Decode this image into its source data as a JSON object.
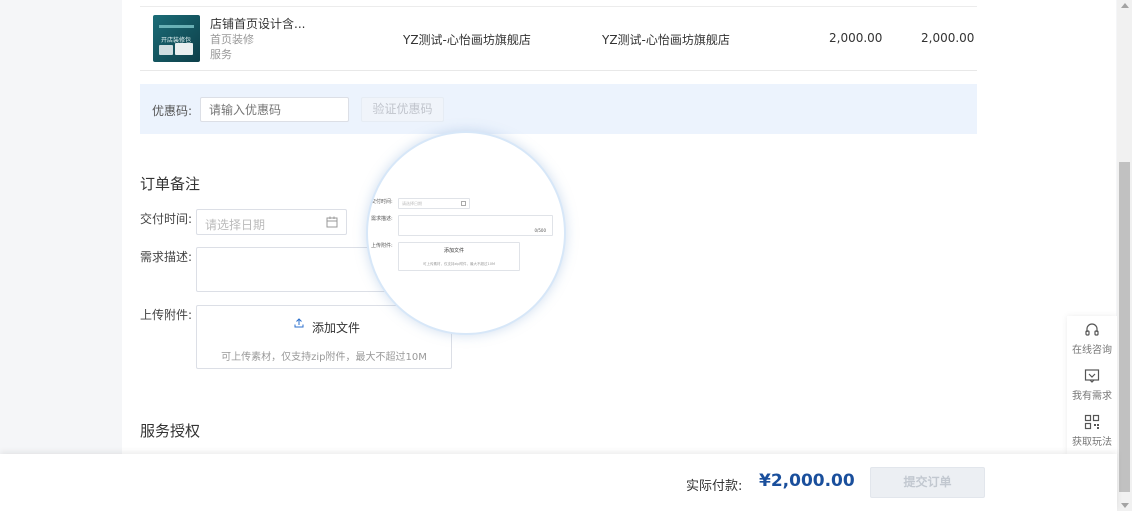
{
  "product": {
    "name": "店铺首页设计含...",
    "category": "首页装修",
    "type": "服务",
    "shop_name": "YZ测试-心怡画坊旗舰店",
    "service_provider": "YZ测试-心怡画坊旗舰店",
    "unit_price": "2,000.00",
    "subtotal": "2,000.00",
    "thumb_caption": "开店装修包"
  },
  "coupon": {
    "label": "优惠码:",
    "placeholder": "请输入优惠码",
    "verify_label": "验证优惠码"
  },
  "order_notes": {
    "title": "订单备注",
    "delivery_label": "交付时间:",
    "delivery_placeholder": "请选择日期",
    "desc_label": "需求描述:",
    "upload_label": "上传附件:",
    "upload_button": "添加文件",
    "upload_hint": "可上传素材，仅支持zip附件，最大不超过10M"
  },
  "magnifier": {
    "delivery_label": "交付时间:",
    "delivery_placeholder": "请选择日期",
    "desc_label": "需求描述:",
    "counter": "0/500",
    "upload_label": "上传附件:",
    "upload_button": "添加文件",
    "upload_hint": "可上传素材，仅支持zip附件，最大不超过10M"
  },
  "service_auth": {
    "title": "服务授权"
  },
  "side_panel": {
    "consult": "在线咨询",
    "demand": "我有需求",
    "more": "获取玩法"
  },
  "payment": {
    "label": "实际付款:",
    "amount": "¥2,000.00",
    "submit": "提交订单"
  },
  "colors": {
    "accent": "#1a4f9c",
    "coupon_bg": "#ecf3fd"
  }
}
